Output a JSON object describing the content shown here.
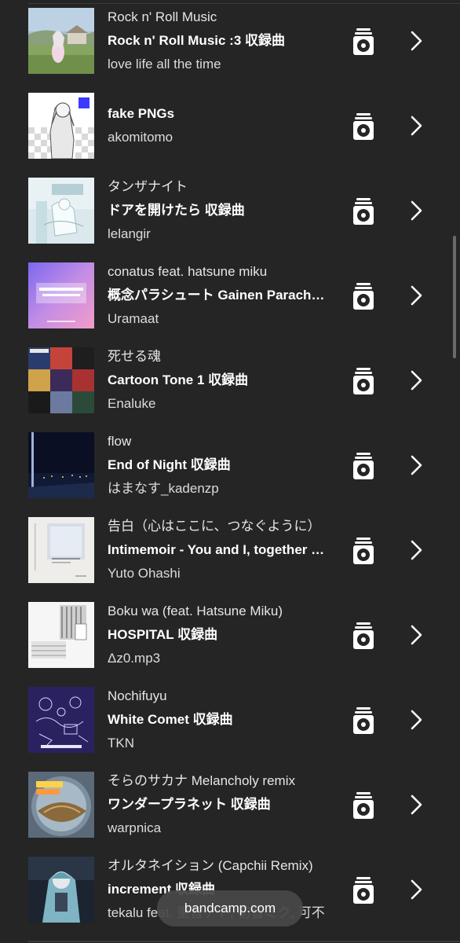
{
  "tracks": [
    {
      "title": "Rock n' Roll Music",
      "album": "Rock n' Roll Music :3 収録曲",
      "artist": "love life all the time",
      "art": "rock-n-roll-music-cover"
    },
    {
      "title": "",
      "album": "fake PNGs",
      "artist": "akomitomo",
      "art": "fake-pngs-cover"
    },
    {
      "title": "タンザナイト",
      "album": "ドアを開けたら 収録曲",
      "artist": "lelangir",
      "art": "doa-wo-aketara-cover"
    },
    {
      "title": "conatus feat. hatsune miku",
      "album": "概念パラシュート Gainen Parachute 収録曲",
      "artist": "Uramaat",
      "art": "gainen-parachute-cover"
    },
    {
      "title": "死せる魂",
      "album": "Cartoon Tone 1 収録曲",
      "artist": "Enaluke",
      "art": "cartoon-tone-1-cover"
    },
    {
      "title": "flow",
      "album": "End of Night 収録曲",
      "artist": "はまなす_kadenzp",
      "art": "end-of-night-cover"
    },
    {
      "title": "告白（心はここに、つなぐように）",
      "album": "Intimemoir - You and I, together 収録曲",
      "artist": "Yuto Ohashi",
      "art": "intimemoir-cover"
    },
    {
      "title": "Boku wa (feat. Hatsune Miku)",
      "album": "HOSPITAL 収録曲",
      "artist": "Δz0.mp3",
      "art": "hospital-cover"
    },
    {
      "title": "Nochifuyu",
      "album": "White Comet 収録曲",
      "artist": "TKN",
      "art": "white-comet-cover"
    },
    {
      "title": "そらのサカナ Melancholy remix",
      "album": "ワンダープラネット  収録曲",
      "artist": "warpnica",
      "art": "wonder-planet-cover"
    },
    {
      "title": "オルタネイション (Capchii Remix)",
      "album": "increment 収録曲",
      "artist": "tekalu feat. 重音テト, 初音ミク, 可不",
      "art": "increment-cover"
    }
  ],
  "icons": {
    "disc": "vinyl-record-icon",
    "chevron": "chevron-right-icon"
  },
  "toast": {
    "domain": "bandcamp.com"
  },
  "colors": {
    "background": "#252525",
    "text": "#ffffff",
    "subtext": "#dcdcdc",
    "pill": "#484848"
  }
}
